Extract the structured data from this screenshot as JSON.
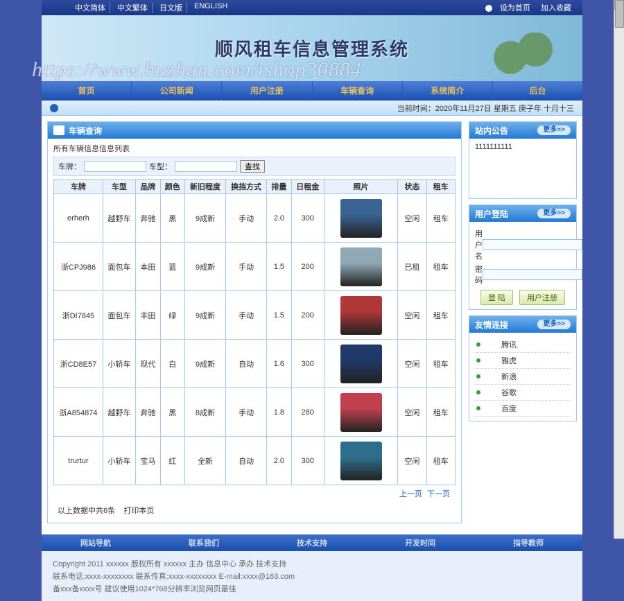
{
  "langs": [
    "中文简体",
    "中文繁体",
    "日文版",
    "ENGLISH"
  ],
  "topright": {
    "set_home": "设为首页",
    "add_fav": "加入收藏"
  },
  "banner_title": "顺风租车信息管理系统",
  "watermark": "https://www.huzhan.com/ishop30884",
  "nav": [
    "首页",
    "公司新闻",
    "用户注册",
    "车辆查询",
    "系统简介",
    "后台"
  ],
  "timebar": {
    "label": "当前时间：",
    "value": "2020年11月27日 星期五 庚子年 十月十三"
  },
  "list_panel": {
    "title": "车辆查询",
    "subtitle": "所有车辆信息信息列表",
    "search": {
      "label1": "车牌：",
      "label2": "车型：",
      "btn": "查找"
    },
    "headers": [
      "车牌",
      "车型",
      "品牌",
      "颜色",
      "新旧程度",
      "换挡方式",
      "排量",
      "日租金",
      "照片",
      "状态",
      "租车"
    ],
    "rows": [
      {
        "plate": "erherh",
        "type": "越野车",
        "brand": "奔驰",
        "color": "黑",
        "cond": "9成新",
        "gear": "手动",
        "disp": "2.0",
        "rent": "300",
        "img": "#3a6492",
        "status": "空闲",
        "act": "租车"
      },
      {
        "plate": "浙CPJ986",
        "type": "面包车",
        "brand": "本田",
        "color": "蓝",
        "cond": "9成新",
        "gear": "手动",
        "disp": "1.5",
        "rent": "200",
        "img": "#8fa8b4",
        "status": "已租",
        "act": "租车"
      },
      {
        "plate": "浙DI7845",
        "type": "面包车",
        "brand": "丰田",
        "color": "绿",
        "cond": "9成新",
        "gear": "手动",
        "disp": "1.5",
        "rent": "200",
        "img": "#b03838",
        "status": "空闲",
        "act": "租车"
      },
      {
        "plate": "浙CD8E57",
        "type": "小轿车",
        "brand": "现代",
        "color": "白",
        "cond": "9成新",
        "gear": "自动",
        "disp": "1.6",
        "rent": "300",
        "img": "#1f3a68",
        "status": "空闲",
        "act": "租车"
      },
      {
        "plate": "浙A854874",
        "type": "越野车",
        "brand": "奔驰",
        "color": "黑",
        "cond": "8成新",
        "gear": "手动",
        "disp": "1.8",
        "rent": "280",
        "img": "#c04050",
        "status": "空闲",
        "act": "租车"
      },
      {
        "plate": "trurtur",
        "type": "小轿车",
        "brand": "宝马",
        "color": "红",
        "cond": "全新",
        "gear": "自动",
        "disp": "2.0",
        "rent": "300",
        "img": "#2e6e8c",
        "status": "空闲",
        "act": "租车"
      }
    ],
    "pager": {
      "prev": "上一页",
      "next": "下一页"
    },
    "footer": {
      "count": "以上数据中共6条",
      "print": "打印本页"
    }
  },
  "announce": {
    "title": "站内公告",
    "more": "更多>>",
    "content": "1111111111"
  },
  "login": {
    "title": "用户登陆",
    "more": "更多>>",
    "user_lbl": "用户名",
    "pwd_lbl": "密码",
    "login_btn": "登 陆",
    "reg_btn": "用户注册"
  },
  "links": {
    "title": "友情连接",
    "more": "更多>>",
    "items": [
      "腾讯",
      "雅虎",
      "新浪",
      "谷歌",
      "百度"
    ]
  },
  "botnav": [
    "网站导航",
    "联系我们",
    "技术支持",
    "开发时间",
    "指导教师"
  ],
  "copyright": [
    "Copyright 2011 xxxxxx 版权所有 xxxxxx 主办 信息中心 承办 技术支持",
    "联系电话:xxxx-xxxxxxxx 联系传真:xxxx-xxxxxxxx E-mail:xxxx@163.com",
    "备xxx备xxxx号    建议使用1024*768分辨率浏览网页最佳"
  ]
}
